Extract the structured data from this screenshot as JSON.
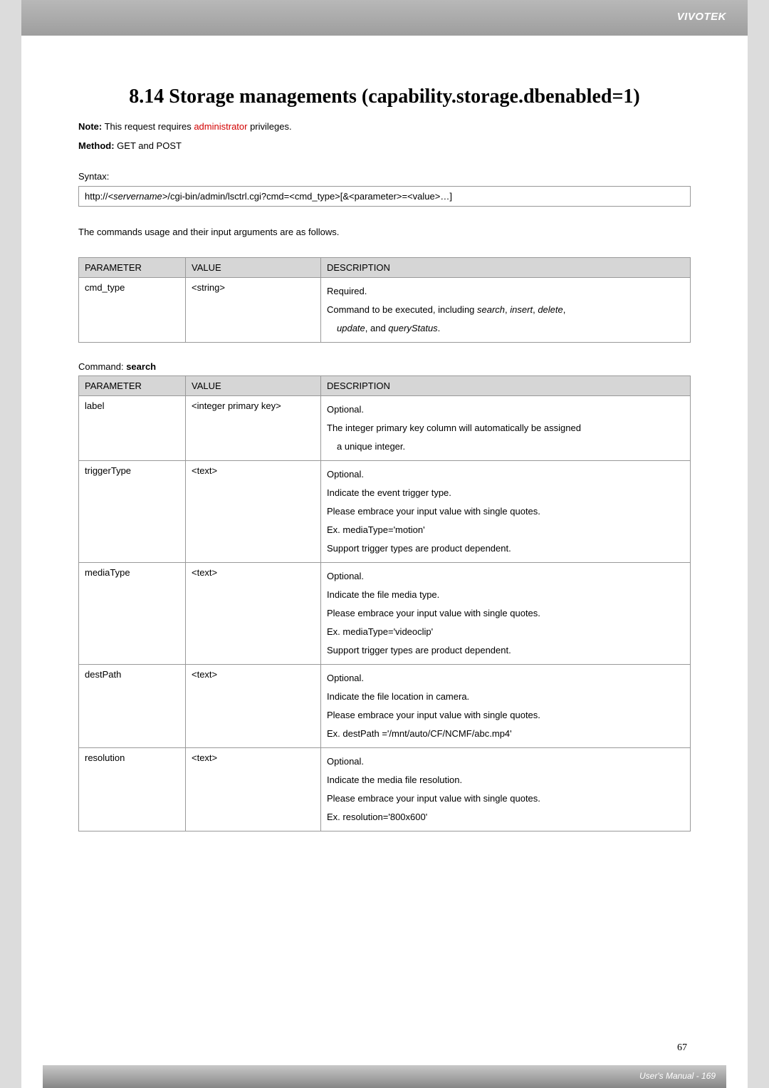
{
  "brand": "VIVOTEK",
  "section_title": "8.14 Storage managements (capability.storage.dbenabled=1)",
  "note": {
    "label": "Note:",
    "text_before": " This request requires ",
    "admin": "administrator",
    "text_after": " privileges."
  },
  "method": {
    "label": "Method:",
    "text": " GET and POST"
  },
  "syntax_label": "Syntax:",
  "syntax_prefix": "http://",
  "syntax_servername": "<servername>",
  "syntax_rest": "/cgi-bin/admin/lsctrl.cgi?cmd=<cmd_type>[&<parameter>=<value>…]",
  "usage_line": "The commands usage and their input arguments are as follows.",
  "table1": {
    "headers": {
      "p": "PARAMETER",
      "v": "VALUE",
      "d": "DESCRIPTION"
    },
    "row": {
      "param": "cmd_type",
      "value": "<string>",
      "desc_lines": [
        "Required.",
        "Command to be executed, including search, insert, delete,",
        "update, and queryStatus."
      ]
    }
  },
  "command_label": "Command: ",
  "command_name": "search",
  "table2": {
    "headers": {
      "p": "PARAMETER",
      "v": "VALUE",
      "d": "DESCRIPTION"
    },
    "rows": [
      {
        "param": "label",
        "value": "<integer primary key>",
        "desc_lines": [
          "Optional.",
          "The integer primary key column will automatically be assigned",
          "a unique integer."
        ],
        "indent_last": true
      },
      {
        "param": "triggerType",
        "value": "<text>",
        "desc_lines": [
          "Optional.",
          "Indicate the event trigger type.",
          "Please embrace your input value with single quotes.",
          "Ex. mediaType='motion'",
          "Support trigger types are product dependent."
        ]
      },
      {
        "param": "mediaType",
        "value": "<text>",
        "desc_lines": [
          "Optional.",
          "Indicate the file media type.",
          "Please embrace your input value with single quotes.",
          "Ex. mediaType='videoclip'",
          "Support trigger types are product dependent."
        ]
      },
      {
        "param": "destPath",
        "value": "<text>",
        "desc_lines": [
          "Optional.",
          "Indicate the file location in camera.",
          "Please embrace your input value with single quotes.",
          "Ex. destPath ='/mnt/auto/CF/NCMF/abc.mp4'"
        ]
      },
      {
        "param": "resolution",
        "value": "<text>",
        "desc_lines": [
          "Optional.",
          "Indicate the media file resolution.",
          "Please embrace your input value with single quotes.",
          "Ex. resolution='800x600'"
        ]
      }
    ]
  },
  "footer_pagenum": "67",
  "footer_text": "User's Manual - 169"
}
